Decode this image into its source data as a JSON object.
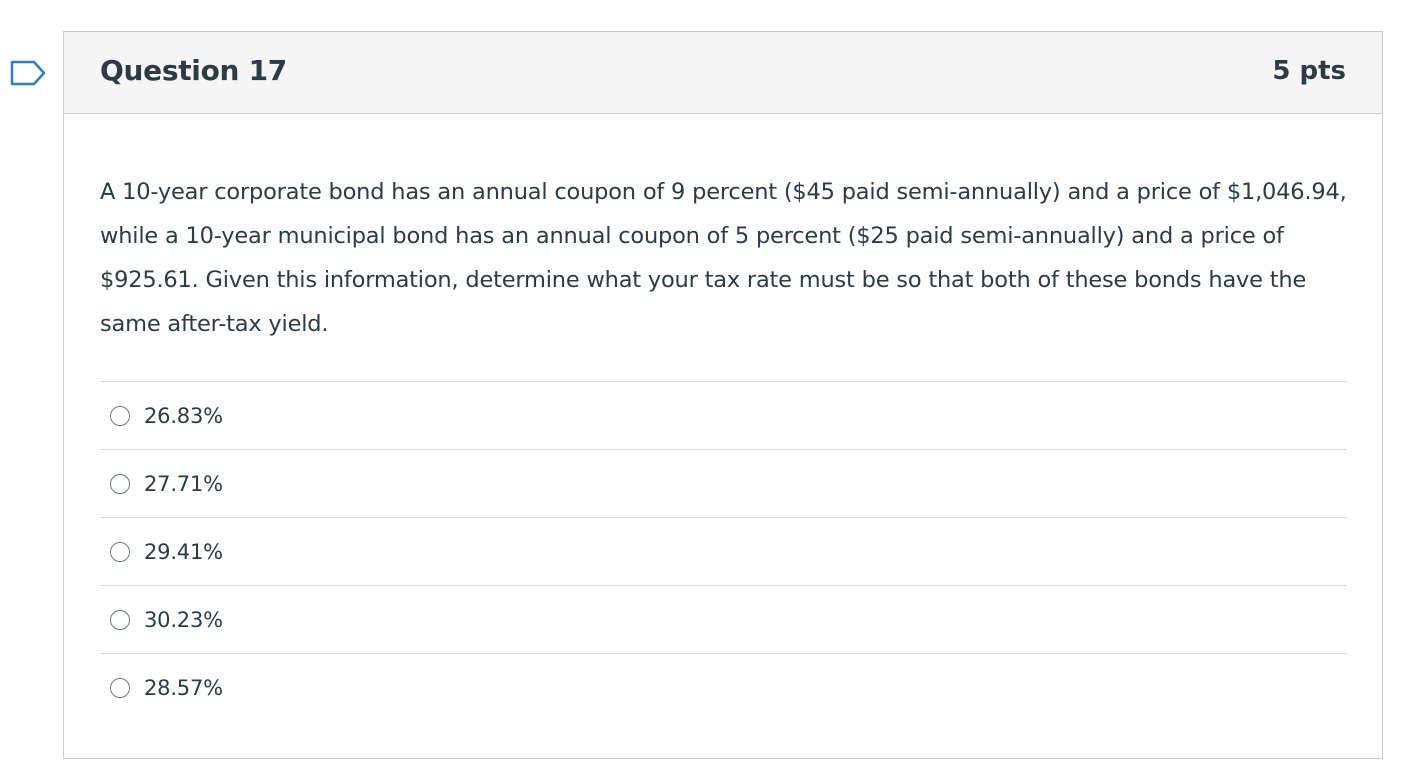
{
  "question": {
    "title": "Question 17",
    "points": "5 pts",
    "text": "A 10-year corporate bond has an annual coupon of 9 percent ($45 paid semi-annually) and a price of $1,046.94, while a 10-year municipal bond has an annual coupon of 5 percent ($25 paid semi-annually) and a price of $925.61.  Given this information, determine what your tax rate must be so that both of these bonds have the same after-tax yield.",
    "flag_icon": "flag-question-icon",
    "answers": [
      {
        "label": "26.83%",
        "selected": false
      },
      {
        "label": "27.71%",
        "selected": false
      },
      {
        "label": "29.41%",
        "selected": false
      },
      {
        "label": "30.23%",
        "selected": false
      },
      {
        "label": "28.57%",
        "selected": false
      }
    ]
  },
  "colors": {
    "header_bg": "#f5f5f5",
    "border": "#c7cdd1",
    "text": "#2d3b45",
    "flag_outline": "#2d7fc1"
  }
}
